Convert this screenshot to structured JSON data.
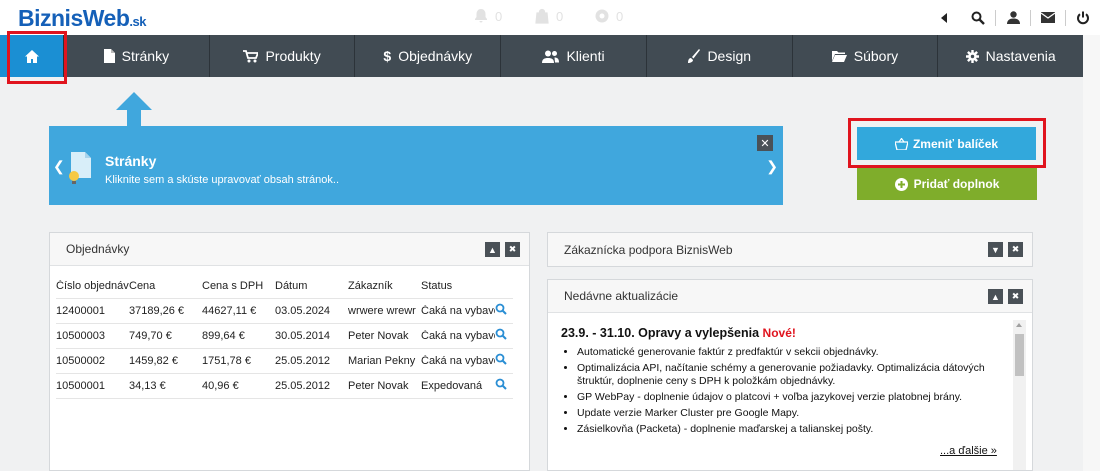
{
  "brand": {
    "name": "BiznisWeb",
    "tld": ".sk"
  },
  "notifications": [
    {
      "icon": "bell-icon",
      "count": "0"
    },
    {
      "icon": "bag-icon",
      "count": "0"
    },
    {
      "icon": "settings-badge-icon",
      "count": "0"
    }
  ],
  "topbar_icons": [
    "arrow-left-icon",
    "search-icon",
    "user-icon",
    "mail-icon",
    "power-icon"
  ],
  "nav": {
    "home_icon": "home-icon",
    "items": [
      {
        "label": "Stránky",
        "icon": "page-icon"
      },
      {
        "label": "Produkty",
        "icon": "cart-icon"
      },
      {
        "label": "Objednávky",
        "icon": "dollar-icon"
      },
      {
        "label": "Klienti",
        "icon": "users-icon"
      },
      {
        "label": "Design",
        "icon": "brush-icon"
      },
      {
        "label": "Súbory",
        "icon": "folder-icon"
      },
      {
        "label": "Nastavenia",
        "icon": "gear-icon"
      }
    ]
  },
  "banner": {
    "title": "Stránky",
    "subtitle": "Kliknite sem a skúste upravovať obsah stránok..",
    "close": "✕"
  },
  "buttons": {
    "change_package": "Zmeniť balíček",
    "add_addon": "Pridať doplnok"
  },
  "orders_panel": {
    "title": "Objednávky",
    "columns": [
      "Číslo objednávky",
      "Cena",
      "Cena s DPH",
      "Dátum",
      "Zákazník",
      "Status"
    ],
    "rows": [
      [
        "12400001",
        "37189,26 €",
        "44627,11 €",
        "03.05.2024",
        "wrwere wrewr",
        "Čaká na vybavenie"
      ],
      [
        "10500003",
        "749,70 €",
        "899,64 €",
        "30.05.2014",
        "Peter Novak",
        "Čaká na vybavenie"
      ],
      [
        "10500002",
        "1459,82 €",
        "1751,78 €",
        "25.05.2012",
        "Marian Pekny",
        "Čaká na vybavenie"
      ],
      [
        "10500001",
        "34,13 €",
        "40,96 €",
        "25.05.2012",
        "Peter Novak",
        "Expedovaná"
      ]
    ]
  },
  "support_panel": {
    "title": "Zákaznícka podpora BiznisWeb"
  },
  "updates_panel": {
    "title": "Nedávne aktualizácie",
    "heading": "23.9. - 31.10. Opravy a vylepšenia",
    "new_tag": "Nové!",
    "items": [
      "Automatické generovanie faktúr z predfaktúr v sekcii objednávky.",
      "Optimalizácia API, načítanie schémy a generovanie požiadavky. Optimalizácia dátových štruktúr, doplnenie ceny s DPH k položkám objednávky.",
      "GP WebPay - doplnenie údajov o platcovi + voľba jazykovej verzie platobnej brány.",
      "Update verzie Marker Cluster pre Google Mapy.",
      "Zásielkovňa (Packeta) - doplnenie maďarskej a talianskej pošty."
    ],
    "more": "...a ďalšie »"
  }
}
